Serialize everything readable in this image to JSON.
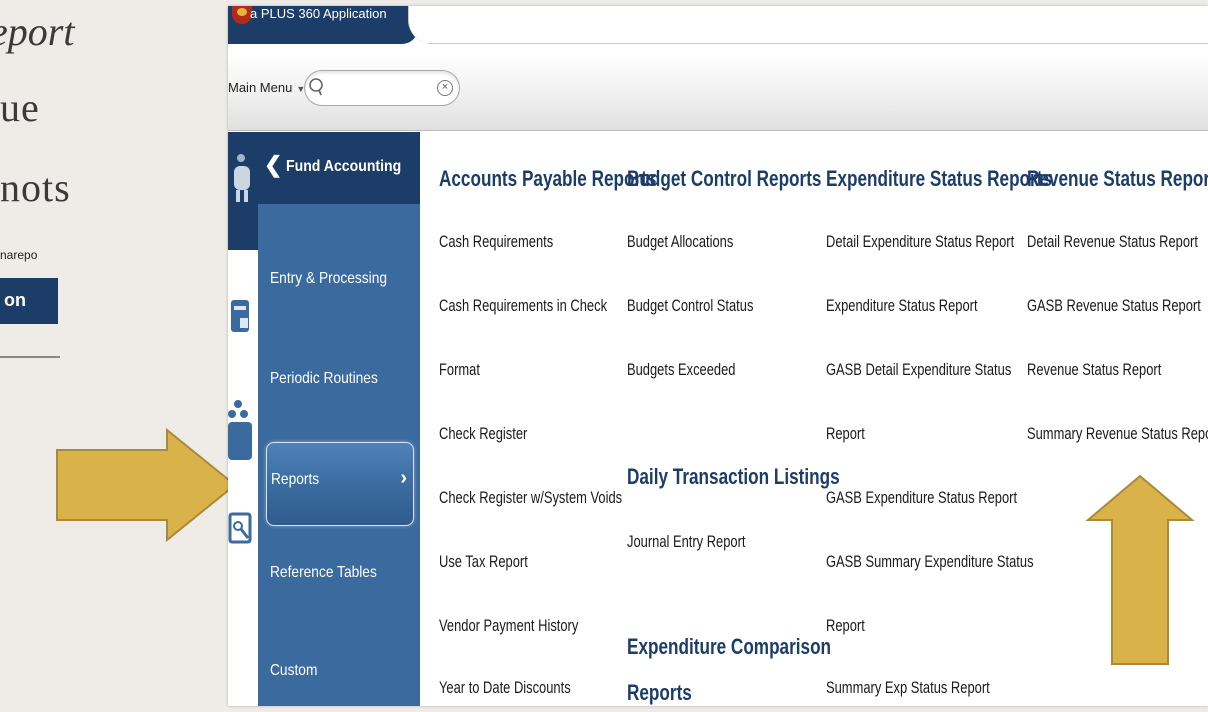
{
  "slide": {
    "line1": "eport",
    "line2": "ue",
    "line3": "nots",
    "thumb_url": "narepo",
    "thumb_tab": "on"
  },
  "app": {
    "title": "a PLUS 360 Application",
    "main_menu": "Main Menu",
    "search_placeholder": ""
  },
  "nav": {
    "header": "Fund Accounting",
    "items": [
      {
        "label": "Entry & Processing"
      },
      {
        "label": "Periodic Routines"
      },
      {
        "label": "Reports",
        "selected": true
      },
      {
        "label": "Reference Tables"
      },
      {
        "label": "Custom"
      }
    ]
  },
  "reports": {
    "accounts_payable": {
      "heading": "Accounts Payable Reports",
      "links": [
        "Cash Requirements",
        "Cash Requirements in Check",
        "Format",
        "Check Register",
        "Check Register w/System Voids",
        "Use Tax Report",
        "Vendor Payment History",
        "Year to Date Discounts"
      ]
    },
    "budget_control": {
      "heading": "Budget Control Reports",
      "links": [
        "Budget Allocations",
        "Budget Control Status",
        "Budgets Exceeded"
      ]
    },
    "daily_transaction": {
      "heading": "Daily Transaction Listings",
      "links": [
        "Journal Entry Report"
      ]
    },
    "expenditure_comparison": {
      "heading_line1": "Expenditure Comparison",
      "heading_line2": "Reports"
    },
    "expenditure_status": {
      "heading": "Expenditure Status Reports",
      "links": [
        "Detail Expenditure Status Report",
        "Expenditure Status Report",
        "GASB Detail Expenditure Status",
        "Report",
        "GASB Expenditure Status Report",
        "GASB Summary Expenditure Status",
        "Report",
        "Summary Exp Status Report"
      ]
    },
    "revenue_status": {
      "heading": "Revenue Status Reports",
      "links": [
        "Detail Revenue Status Report",
        "GASB Revenue Status Report",
        "Revenue Status Report",
        "Summary Revenue Status Report"
      ]
    }
  },
  "colors": {
    "navy": "#1d3d69",
    "nav_blue": "#3a6a9e",
    "arrow_gold": "#d9b24a"
  }
}
